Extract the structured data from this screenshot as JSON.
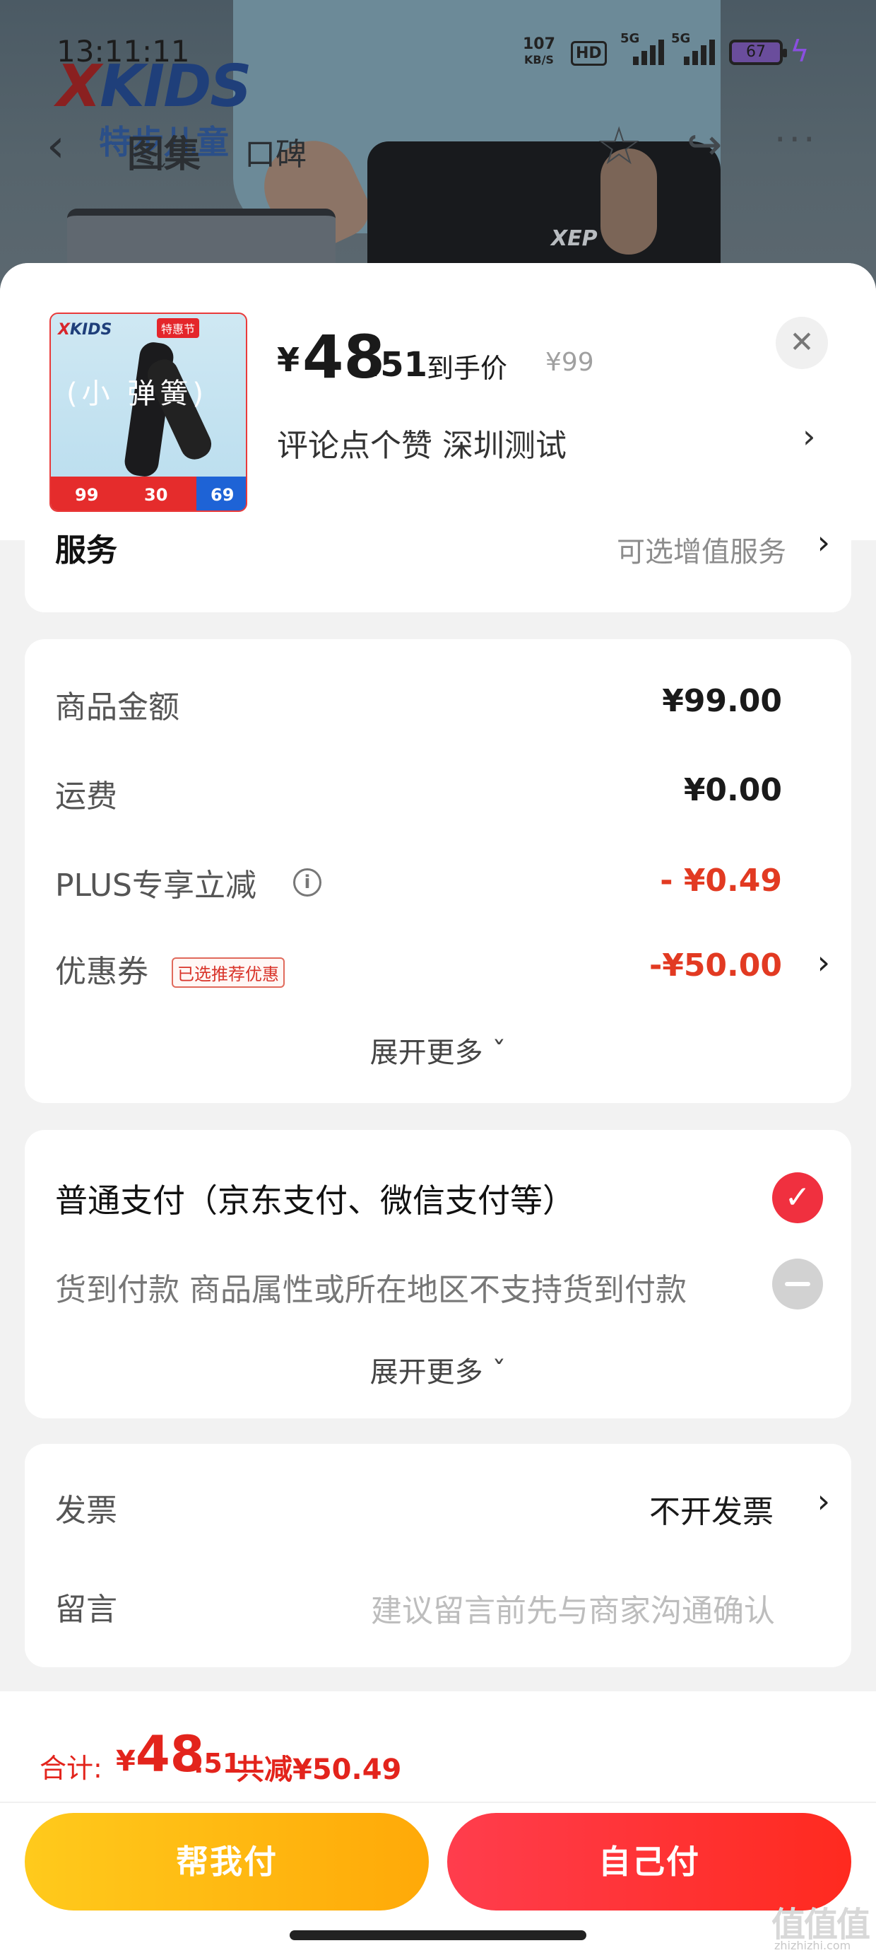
{
  "status_bar": {
    "time": "13:11:11",
    "net_speed_value": "107",
    "net_speed_unit": "KB/S",
    "hd_label": "HD",
    "sig1_label": "5G",
    "sig2_label": "5G",
    "battery": "67"
  },
  "background": {
    "brand_logo": "KIDS",
    "brand_logo_x": "X",
    "brand_sub": "特步儿童",
    "shorts_logo": "XEP"
  },
  "top_nav": {
    "tab1": "图集",
    "tab2": "口碑"
  },
  "product": {
    "thumb_brand": "KIDS",
    "thumb_brand_x": "X",
    "thumb_tag": "特惠节",
    "thumb_text": "(小  弹簧)",
    "thumb_nums": [
      "99",
      "30",
      "69"
    ],
    "price_symbol": "¥",
    "price_int": "48",
    "price_dec": ".51",
    "price_label": "到手价",
    "original_price": "¥99",
    "spec": "评论点个赞  深圳测试"
  },
  "service": {
    "title": "服务",
    "value": "可选增值服务"
  },
  "amount": {
    "rows": [
      {
        "label": "商品金额",
        "value": "¥99.00"
      },
      {
        "label": "运费",
        "value": "¥0.00"
      },
      {
        "label": "PLUS专享立减",
        "value": "- ¥0.49"
      },
      {
        "label": "优惠券",
        "value": "-¥50.00",
        "badge": "已选推荐优惠"
      }
    ],
    "expand": "展开更多 ˇ"
  },
  "payment": {
    "option1": "普通支付（京东支付、微信支付等）",
    "option2": "货到付款 商品属性或所在地区不支持货到付款",
    "expand": "展开更多 ˇ"
  },
  "invoice": {
    "label": "发票",
    "value": "不开发票",
    "message_label": "留言",
    "message_placeholder": "建议留言前先与商家沟通确认"
  },
  "summary": {
    "total_label": "合计:",
    "total_symbol": "¥",
    "total_int": "48",
    "total_dec": ".51",
    "discount": "共减¥50.49"
  },
  "buttons": {
    "help_pay": "帮我付",
    "self_pay": "自己付"
  },
  "watermark": {
    "main": "值值值",
    "sub": "zhizhizhi.com"
  },
  "colors": {
    "accent_red": "#e3241c",
    "help_button": "#ffb80f",
    "self_button": "#ff3030"
  },
  "icons": [
    "back-icon",
    "star-icon",
    "share-icon",
    "more-icon",
    "close-icon",
    "info-icon",
    "chevron-right-icon",
    "check-icon"
  ]
}
